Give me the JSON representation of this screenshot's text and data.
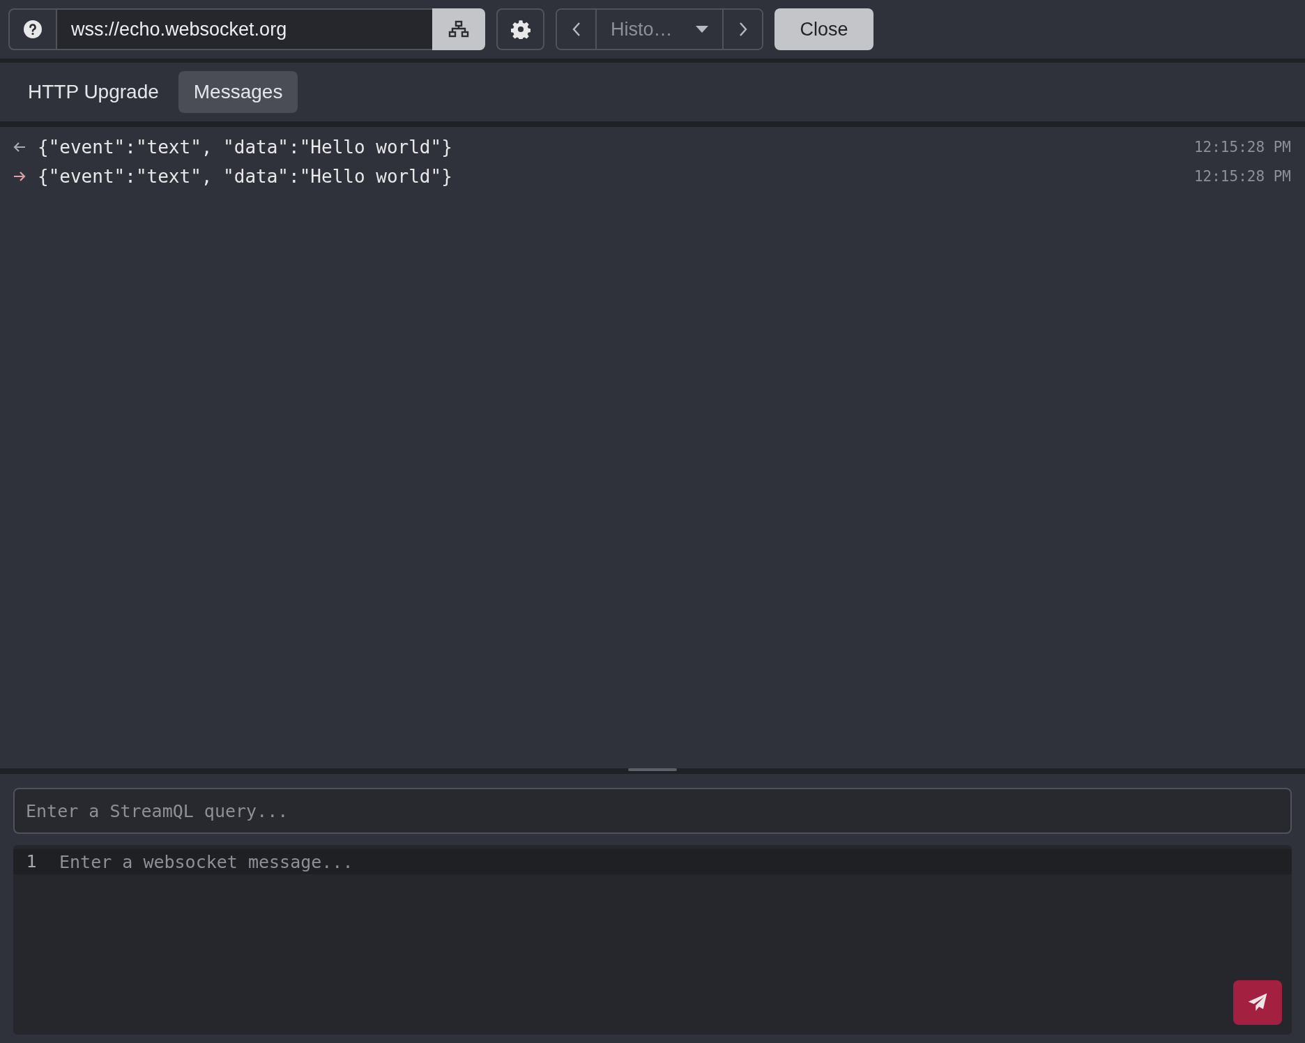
{
  "toolbar": {
    "url": "wss://echo.websocket.org",
    "history": {
      "label": "Histo…"
    },
    "close_button": "Close"
  },
  "tabs": [
    {
      "label": "HTTP Upgrade",
      "selected": false
    },
    {
      "label": "Messages",
      "selected": true
    }
  ],
  "messages": [
    {
      "kind": "in",
      "text": "{\"event\":\"text\", \"data\":\"Hello world\"}",
      "time": "12:15:28 PM"
    },
    {
      "kind": "out",
      "text": "{\"event\":\"text\", \"data\":\"Hello world\"}",
      "time": "12:15:28 PM"
    }
  ],
  "query": {
    "placeholder": "Enter a StreamQL query..."
  },
  "editor": {
    "line_number": "1",
    "placeholder": "Enter a websocket message..."
  }
}
